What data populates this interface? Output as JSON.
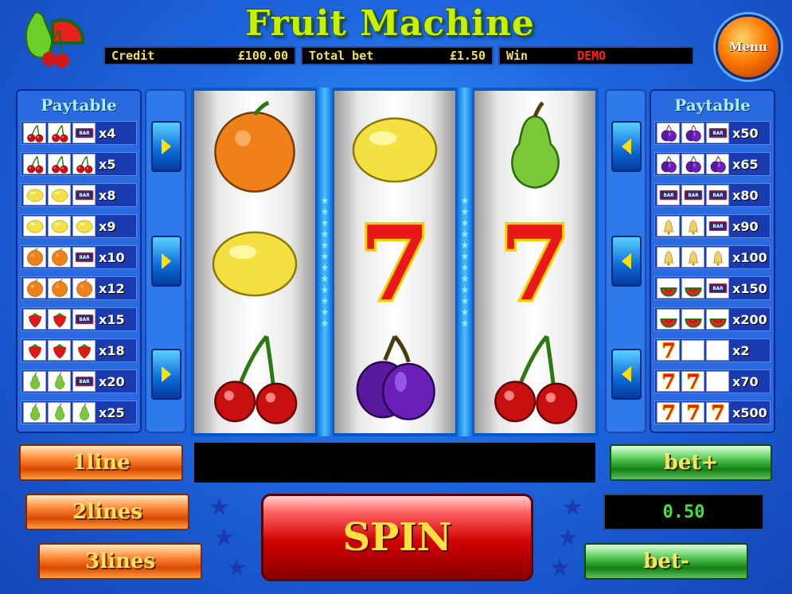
{
  "header": {
    "title": "Fruit Machine",
    "menu_label": "Menu",
    "credit_label": "Credit",
    "credit_value": "£100.00",
    "total_bet_label": "Total bet",
    "total_bet_value": "£1.50",
    "win_label": "Win",
    "win_value": "DEMO"
  },
  "paytable_left": {
    "title": "Paytable",
    "rows": [
      {
        "symbols": [
          "cherry",
          "cherry",
          "bar"
        ],
        "mult": "x4"
      },
      {
        "symbols": [
          "cherry",
          "cherry",
          "cherry"
        ],
        "mult": "x5"
      },
      {
        "symbols": [
          "lemon",
          "lemon",
          "bar"
        ],
        "mult": "x8"
      },
      {
        "symbols": [
          "lemon",
          "lemon",
          "lemon"
        ],
        "mult": "x9"
      },
      {
        "symbols": [
          "orange",
          "orange",
          "bar"
        ],
        "mult": "x10"
      },
      {
        "symbols": [
          "orange",
          "orange",
          "orange"
        ],
        "mult": "x12"
      },
      {
        "symbols": [
          "strawberry",
          "strawberry",
          "bar"
        ],
        "mult": "x15"
      },
      {
        "symbols": [
          "strawberry",
          "strawberry",
          "strawberry"
        ],
        "mult": "x18"
      },
      {
        "symbols": [
          "pear",
          "pear",
          "bar"
        ],
        "mult": "x20"
      },
      {
        "symbols": [
          "pear",
          "pear",
          "pear"
        ],
        "mult": "x25"
      }
    ]
  },
  "paytable_right": {
    "title": "Paytable",
    "rows": [
      {
        "symbols": [
          "plum",
          "plum",
          "bar"
        ],
        "mult": "x50"
      },
      {
        "symbols": [
          "plum",
          "plum",
          "plum"
        ],
        "mult": "x65"
      },
      {
        "symbols": [
          "bar",
          "bar",
          "bar"
        ],
        "mult": "x80"
      },
      {
        "symbols": [
          "bell",
          "bell",
          "bar"
        ],
        "mult": "x90"
      },
      {
        "symbols": [
          "bell",
          "bell",
          "bell"
        ],
        "mult": "x100"
      },
      {
        "symbols": [
          "watermelon",
          "watermelon",
          "bar"
        ],
        "mult": "x150"
      },
      {
        "symbols": [
          "watermelon",
          "watermelon",
          "watermelon"
        ],
        "mult": "x200"
      },
      {
        "symbols": [
          "seven",
          "blank",
          "blank"
        ],
        "mult": "x2"
      },
      {
        "symbols": [
          "seven",
          "seven",
          "blank"
        ],
        "mult": "x70"
      },
      {
        "symbols": [
          "seven",
          "seven",
          "seven"
        ],
        "mult": "x500"
      }
    ]
  },
  "bar_text": "BAR",
  "seven_text": "7",
  "reels": [
    [
      "orange",
      "lemon",
      "cherry"
    ],
    [
      "lemon",
      "seven",
      "plum"
    ],
    [
      "pear",
      "seven",
      "cherry"
    ]
  ],
  "controls": {
    "line1": "1line",
    "line2": "2lines",
    "line3": "3lines",
    "spin": "SPIN",
    "bet_plus": "bet+",
    "bet_value": "0.50",
    "bet_minus": "bet-"
  },
  "colors": {
    "title": "#c8f000",
    "seven": "#e81818",
    "bet_display": "#40e040",
    "win_demo": "#ff2020"
  }
}
